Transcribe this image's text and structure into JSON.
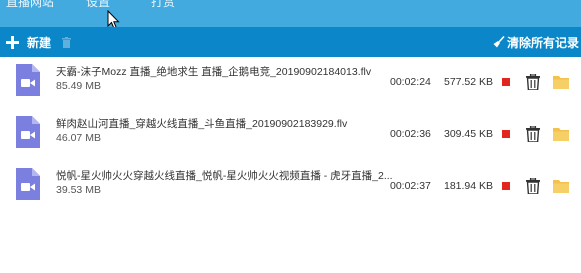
{
  "nav": {
    "tabs": [
      {
        "label": "直播网站"
      },
      {
        "label": "设置"
      },
      {
        "label": "打赏"
      }
    ]
  },
  "toolbar": {
    "new_label": "新建",
    "clear_label": "清除所有记录"
  },
  "colors": {
    "nav_bg": "#42aadf",
    "toolbar_bg": "#0a86c9",
    "file_icon": "#7b7fe0",
    "stop": "#e0261d",
    "folder": "#f2c14e"
  },
  "icons": {
    "new": "plus-icon",
    "delete": "trash-icon",
    "clear": "broom-icon",
    "file": "video-file-icon",
    "stop": "stop-icon",
    "folder": "folder-icon"
  },
  "recordings": [
    {
      "name": "天霸-沫子Mozz 直播_绝地求生 直播_企鹅电竞_20190902184013.flv",
      "size": "85.49 MB",
      "duration": "00:02:24",
      "bytes": "577.52 KB"
    },
    {
      "name": "鲜肉赵山河直播_穿越火线直播_斗鱼直播_20190902183929.flv",
      "size": "46.07 MB",
      "duration": "00:02:36",
      "bytes": "309.45 KB"
    },
    {
      "name": "悦帆-星火帅火火穿越火线直播_悦帆-星火帅火火视频直播 - 虎牙直播_2...",
      "size": "39.53 MB",
      "duration": "00:02:37",
      "bytes": "181.94 KB"
    }
  ]
}
